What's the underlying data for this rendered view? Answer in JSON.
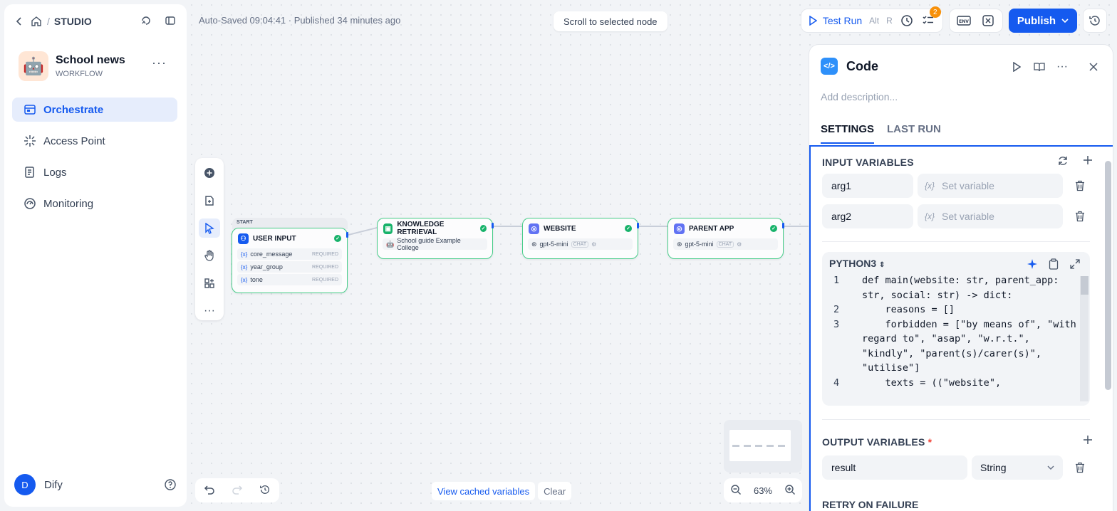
{
  "sidebar": {
    "studio_label": "STUDIO",
    "app_name": "School news",
    "app_type": "WORKFLOW",
    "app_avatar": "🤖",
    "nav": [
      {
        "label": "Orchestrate",
        "icon": "orchestrate-icon",
        "active": true
      },
      {
        "label": "Access Point",
        "icon": "access-point-icon",
        "active": false
      },
      {
        "label": "Logs",
        "icon": "logs-icon",
        "active": false
      },
      {
        "label": "Monitoring",
        "icon": "monitoring-icon",
        "active": false
      }
    ],
    "user_initial": "D",
    "user_name": "Dify"
  },
  "header": {
    "autosave": "Auto-Saved 09:04:41 · Published 34 minutes ago",
    "scroll_to_node": "Scroll to selected node",
    "test_run": "Test Run",
    "test_run_keys": [
      "Alt",
      "R"
    ],
    "checklist_badge": "2",
    "env_label": "ENV",
    "publish": "Publish"
  },
  "canvas": {
    "start_label": "START",
    "nodes": {
      "user_input": {
        "title": "USER INPUT",
        "vars": [
          {
            "prefix": "{x}",
            "name": "core_message",
            "tag": "REQUIRED"
          },
          {
            "prefix": "{x}",
            "name": "year_group",
            "tag": "REQUIRED"
          },
          {
            "prefix": "{x}",
            "name": "tone",
            "tag": "REQUIRED"
          }
        ]
      },
      "knowledge": {
        "title": "KNOWLEDGE RETRIEVAL",
        "dataset": "School guide Example College"
      },
      "website": {
        "title": "WEBSITE",
        "model": "gpt-5-mini",
        "chip": "CHAT"
      },
      "parent_app": {
        "title": "PARENT APP",
        "model": "gpt-5-mini",
        "chip": "CHAT"
      }
    },
    "view_cached": "View cached variables",
    "clear": "Clear",
    "zoom": "63%"
  },
  "panel": {
    "title": "Code",
    "description_placeholder": "Add description...",
    "tabs": [
      "SETTINGS",
      "LAST RUN"
    ],
    "input_title": "INPUT VARIABLES",
    "inputs": [
      {
        "name": "arg1",
        "placeholder": "Set variable",
        "prefix": "{x}"
      },
      {
        "name": "arg2",
        "placeholder": "Set variable",
        "prefix": "{x}"
      }
    ],
    "language": "PYTHON3",
    "code_lines": [
      {
        "n": "1",
        "text": "def main(website: str, parent_app: str, social: str) -> dict:"
      },
      {
        "n": "2",
        "text": "    reasons = []"
      },
      {
        "n": "3",
        "text": "    forbidden = [\"by means of\", \"with regard to\", \"asap\", \"w.r.t.\", \"kindly\", \"parent(s)/carer(s)\", \"utilise\"]"
      },
      {
        "n": "4",
        "text": "    texts = ((\"website\","
      }
    ],
    "output_title": "OUTPUT VARIABLES",
    "output_required": "*",
    "output": {
      "name": "result",
      "type": "String"
    },
    "retry_title": "RETRY ON FAILURE"
  },
  "colors": {
    "accent": "#155aef",
    "success": "#17b26a",
    "badge": "#f79009"
  }
}
